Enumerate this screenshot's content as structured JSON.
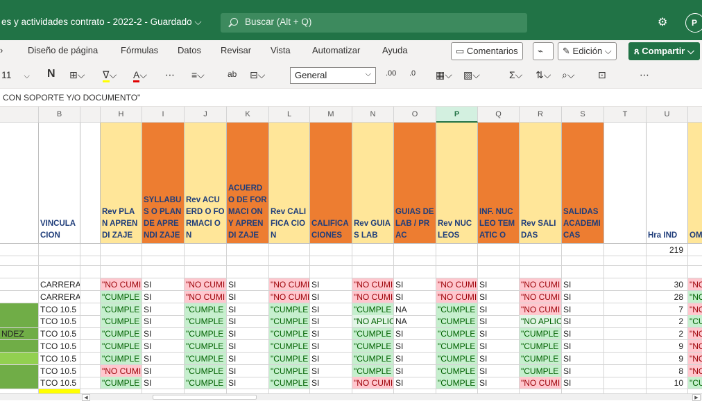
{
  "titlebar": {
    "title": "es y actividades contrato - 2022-2  -  Guardado",
    "title_caret": "⌵",
    "search_placeholder": "Buscar (Alt + Q)",
    "settings_icon": "gear-icon",
    "avatar": "P"
  },
  "menu": {
    "items": [
      "Diseño de página",
      "Fórmulas",
      "Datos",
      "Revisar",
      "Vista",
      "Automatizar",
      "Ayuda"
    ],
    "comments": "Comentarios",
    "edit_mode": "Edición",
    "share": "Compartir"
  },
  "ribbon": {
    "font_size": "11",
    "bold": "N",
    "number_format": "General"
  },
  "formula_bar": {
    "text": "CON SOPORTE Y/O DOCUMENTO\""
  },
  "columns": [
    {
      "letter": "",
      "header": ""
    },
    {
      "letter": "B",
      "header": "VINCULA CION"
    },
    {
      "letter": "H",
      "header": "Rev PLAN APRENDI ZAJE"
    },
    {
      "letter": "I",
      "header": "SYLLABUS O PLAN DE APRENDI ZAJE"
    },
    {
      "letter": "J",
      "header": "Rev ACUERD O FORMACI ON"
    },
    {
      "letter": "K",
      "header": "ACUERD O DE FORMACI ON Y APRENDI ZAJE"
    },
    {
      "letter": "L",
      "header": "Rev CALIFICA CION"
    },
    {
      "letter": "M",
      "header": "CALIFICA CIONES"
    },
    {
      "letter": "N",
      "header": "Rev GUIAS LAB"
    },
    {
      "letter": "O",
      "header": "GUIAS DE LAB / PRAC"
    },
    {
      "letter": "P",
      "header": "Rev NUCLEOS"
    },
    {
      "letter": "Q",
      "header": "INF. NUCLEO TEMATIC O"
    },
    {
      "letter": "R",
      "header": "Rev SALIDAS"
    },
    {
      "letter": "S",
      "header": "SALIDAS ACADEMI CAS"
    },
    {
      "letter": "T",
      "header": ""
    },
    {
      "letter": "U",
      "header": "Hra IND"
    },
    {
      "letter": "",
      "header": "OM"
    }
  ],
  "total_row": {
    "u": "219"
  },
  "rows": [
    {
      "a": "",
      "b": "CARRERA",
      "h": "\"NO CUMI",
      "i": "SI",
      "j": "\"NO CUMI",
      "k": "SI",
      "l": "\"NO CUMI",
      "m": "SI",
      "n": "\"NO CUMI",
      "o": "SI",
      "p": "\"NO CUMI",
      "q": "SI",
      "r": "\"NO CUMI",
      "s": "SI",
      "u": "30",
      "v": "\"NO"
    },
    {
      "a": "",
      "b": "CARRERA",
      "h": "\"CUMPLE",
      "i": "SI",
      "j": "\"NO CUMI",
      "k": "SI",
      "l": "\"NO CUMI",
      "m": "SI",
      "n": "\"NO CUMI",
      "o": "SI",
      "p": "\"NO CUMI",
      "q": "SI",
      "r": "\"NO CUMI",
      "s": "SI",
      "u": "28",
      "v": "\"NC"
    },
    {
      "a": "",
      "b": "TCO 10.5",
      "h": "\"CUMPLE",
      "i": "SI",
      "j": "\"CUMPLE",
      "k": "SI",
      "l": "\"CUMPLE",
      "m": "SI",
      "n": "\"CUMPLE",
      "o": "NA",
      "p": "\"CUMPLE",
      "q": "SI",
      "r": "\"NO CUMI",
      "s": "SI",
      "u": "7",
      "v": "\"NO"
    },
    {
      "a": "",
      "b": "TCO 10.5",
      "h": "\"CUMPLE",
      "i": "SI",
      "j": "\"CUMPLE",
      "k": "SI",
      "l": "\"CUMPLE",
      "m": "SI",
      "n": "\"NO APLIC",
      "o": "NA",
      "p": "\"CUMPLE",
      "q": "SI",
      "r": "\"NO APLIC",
      "s": "SI",
      "u": "2",
      "v": "\"CU"
    },
    {
      "a": "NDEZ",
      "b": "TCO 10.5",
      "h": "\"CUMPLE",
      "i": "SI",
      "j": "\"CUMPLE",
      "k": "SI",
      "l": "\"CUMPLE",
      "m": "SI",
      "n": "\"CUMPLE",
      "o": "SI",
      "p": "\"CUMPLE",
      "q": "SI",
      "r": "\"CUMPLE",
      "s": "SI",
      "u": "2",
      "v": "\"NO"
    },
    {
      "a": "",
      "b": "TCO 10.5",
      "h": "\"CUMPLE",
      "i": "SI",
      "j": "\"CUMPLE",
      "k": "SI",
      "l": "\"CUMPLE",
      "m": "SI",
      "n": "\"CUMPLE",
      "o": "SI",
      "p": "\"CUMPLE",
      "q": "SI",
      "r": "\"CUMPLE",
      "s": "SI",
      "u": "9",
      "v": "\"NO"
    },
    {
      "a": "",
      "b": "TCO 10.5",
      "h": "\"CUMPLE",
      "i": "SI",
      "j": "\"CUMPLE",
      "k": "SI",
      "l": "\"CUMPLE",
      "m": "SI",
      "n": "\"CUMPLE",
      "o": "SI",
      "p": "\"CUMPLE",
      "q": "SI",
      "r": "\"CUMPLE",
      "s": "SI",
      "u": "9",
      "v": "\"NO"
    },
    {
      "a": "",
      "b": "TCO 10.5",
      "h": "\"NO CUMI",
      "i": "SI",
      "j": "\"CUMPLE",
      "k": "SI",
      "l": "\"CUMPLE",
      "m": "SI",
      "n": "\"CUMPLE",
      "o": "SI",
      "p": "\"CUMPLE",
      "q": "SI",
      "r": "\"CUMPLE",
      "s": "SI",
      "u": "8",
      "v": "\"NO"
    },
    {
      "a": "",
      "b": "TCO 10.5",
      "h": "\"CUMPLE",
      "i": "SI",
      "j": "\"CUMPLE",
      "k": "SI",
      "l": "\"CUMPLE",
      "m": "SI",
      "n": "\"NO CUMI",
      "o": "SI",
      "p": "\"CUMPLE",
      "q": "SI",
      "r": "\"NO CUMI",
      "s": "SI",
      "u": "10",
      "v": "\"CU"
    }
  ],
  "colors": {
    "brand": "#217346",
    "header_yellow": "#ffe699",
    "header_orange": "#ed7d31",
    "bad_fill": "#ffc7ce",
    "good_fill": "#c6efce"
  }
}
